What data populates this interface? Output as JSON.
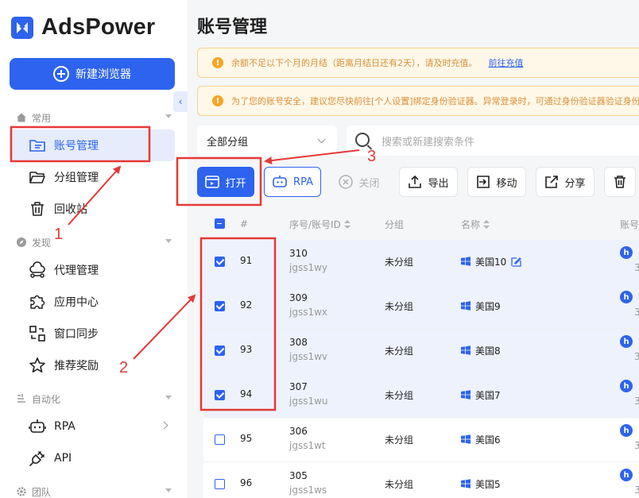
{
  "app": {
    "name": "AdsPower"
  },
  "sidebar": {
    "new_browser": "新建浏览器",
    "sections": [
      {
        "label": "常用"
      },
      {
        "label": "发现"
      },
      {
        "label": "自动化"
      },
      {
        "label": "团队"
      }
    ],
    "items": [
      {
        "label": "账号管理",
        "icon": "account-list-icon",
        "active": true
      },
      {
        "label": "分组管理",
        "icon": "folder-icon"
      },
      {
        "label": "回收站",
        "icon": "trash-icon"
      },
      {
        "label": "代理管理",
        "icon": "proxy-icon"
      },
      {
        "label": "应用中心",
        "icon": "puzzle-icon"
      },
      {
        "label": "窗口同步",
        "icon": "sync-icon"
      },
      {
        "label": "推荐奖励",
        "icon": "star-icon"
      },
      {
        "label": "RPA",
        "icon": "robot-icon"
      },
      {
        "label": "API",
        "icon": "plug-icon"
      }
    ]
  },
  "main": {
    "title": "账号管理",
    "notices": [
      {
        "text": "余额不足以下个月的月结（距离月结日还有2天），请及时充值。",
        "link": "前往充值"
      },
      {
        "text": "为了您的账号安全，建议您尽快前往[个人设置]绑定身份验证器。异常登录时，可通过身份验证器验证身份"
      }
    ],
    "group_select": "全部分组",
    "search_placeholder": "搜索或新建搜索条件",
    "toolbar": {
      "open": "打开",
      "rpa": "RPA",
      "close": "关闭",
      "export": "导出",
      "move": "移动",
      "share": "分享"
    },
    "table": {
      "headers": {
        "num": "#",
        "id": "序号/账号ID",
        "group": "分组",
        "name": "名称",
        "account": "账号"
      },
      "rows": [
        {
          "num": "91",
          "seq": "310",
          "account_id": "jgss1wy",
          "group": "未分组",
          "name": "美国10",
          "checked": true,
          "ext": "3"
        },
        {
          "num": "92",
          "seq": "309",
          "account_id": "jgss1wx",
          "group": "未分组",
          "name": "美国9",
          "checked": true,
          "ext": "3"
        },
        {
          "num": "93",
          "seq": "308",
          "account_id": "jgss1wv",
          "group": "未分组",
          "name": "美国8",
          "checked": true,
          "ext": "3"
        },
        {
          "num": "94",
          "seq": "307",
          "account_id": "jgss1wu",
          "group": "未分组",
          "name": "美国7",
          "checked": true,
          "ext": "3"
        },
        {
          "num": "95",
          "seq": "306",
          "account_id": "jgss1wt",
          "group": "未分组",
          "name": "美国6",
          "checked": false,
          "ext": "3"
        },
        {
          "num": "96",
          "seq": "305",
          "account_id": "jgss1ws",
          "group": "未分组",
          "name": "美国5",
          "checked": false,
          "ext": "3"
        }
      ]
    }
  },
  "annotations": {
    "labels": [
      "1",
      "2",
      "3"
    ],
    "color": "#e53935"
  },
  "colors": {
    "brand": "#2d63ee",
    "warning": "#f5a524",
    "annotation": "#e53935"
  }
}
